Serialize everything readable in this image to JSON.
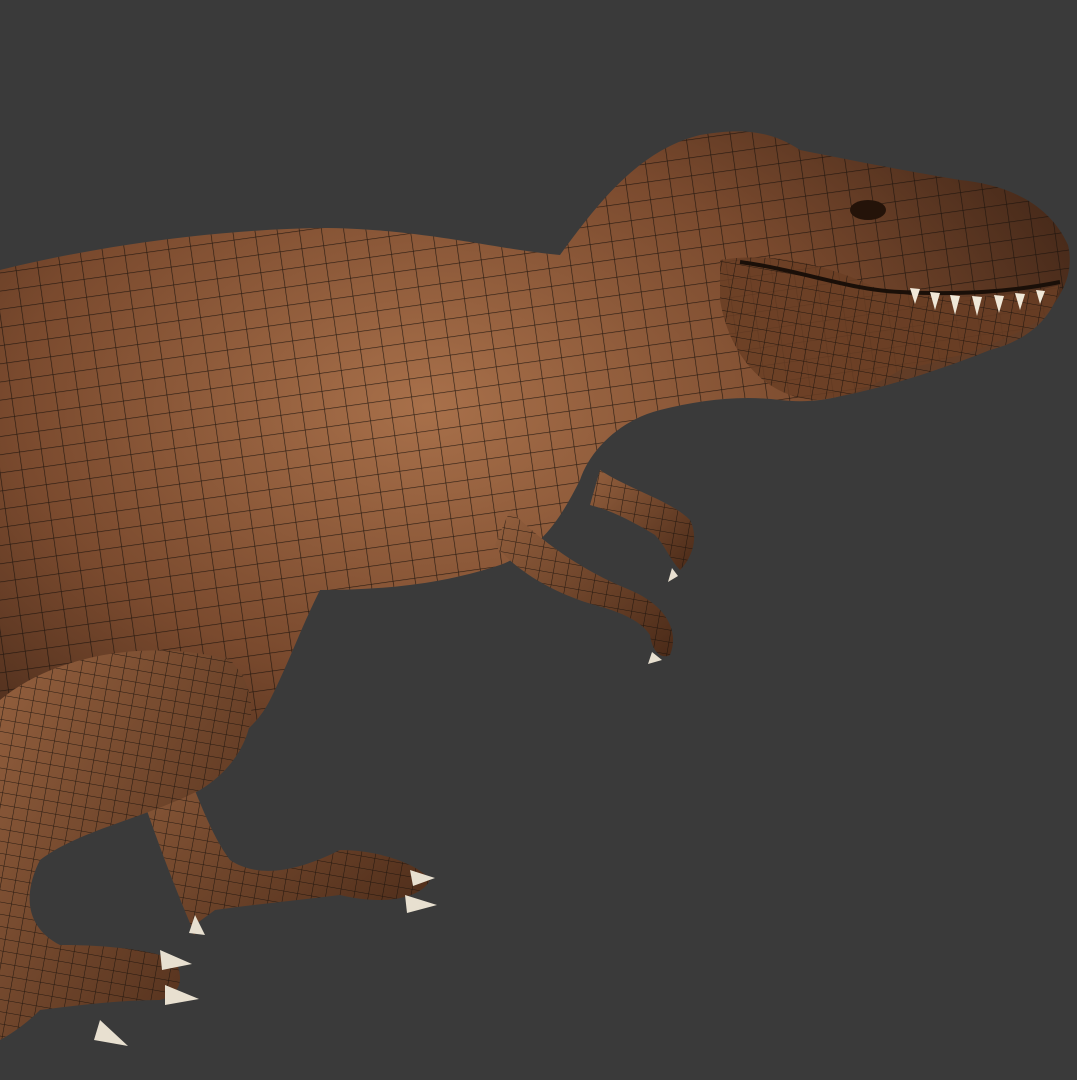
{
  "viewport": {
    "background_color": "#3a3a3a",
    "subject": "dinosaur-3d-model",
    "skin_base_color": "#7a4a2e",
    "skin_highlight_color": "#a8704a",
    "skin_shadow_color": "#3e2416",
    "wireframe_color": "#1a120c",
    "claw_color": "#e8e0d0",
    "teeth_color": "#f0e8d8"
  }
}
